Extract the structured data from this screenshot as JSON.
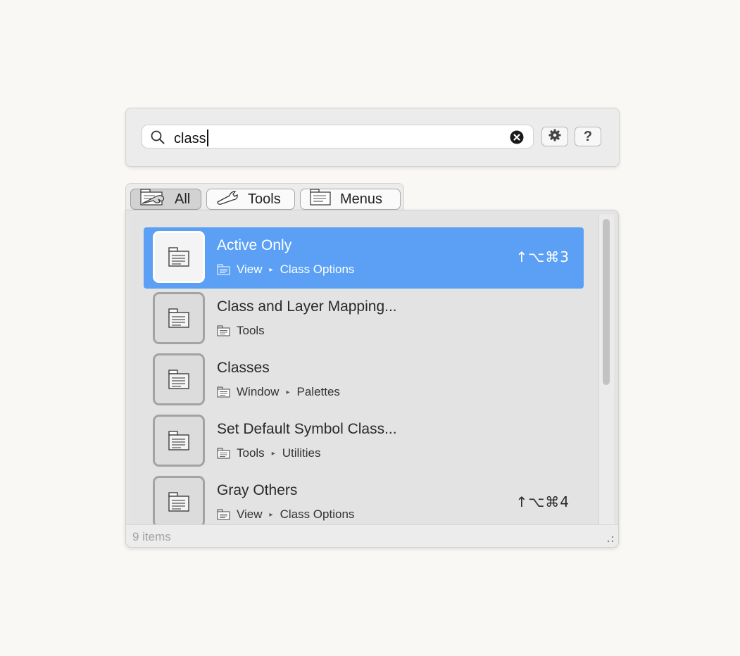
{
  "search": {
    "query": "class",
    "placeholder": ""
  },
  "toolbar": {
    "settings_icon": "gear-icon",
    "help_label": "?"
  },
  "tabs": [
    {
      "label": "All",
      "icon": "tools-and-menus-icon",
      "active": true
    },
    {
      "label": "Tools",
      "icon": "wrench-icon",
      "active": false
    },
    {
      "label": "Menus",
      "icon": "menu-icon",
      "active": false
    }
  ],
  "results": [
    {
      "title": "Active Only",
      "path": [
        "View",
        "Class Options"
      ],
      "shortcut": "↑⌥⌘3",
      "selected": true
    },
    {
      "title": "Class and Layer Mapping...",
      "path": [
        "Tools"
      ],
      "shortcut": "",
      "selected": false
    },
    {
      "title": "Classes",
      "path": [
        "Window",
        "Palettes"
      ],
      "shortcut": "",
      "selected": false
    },
    {
      "title": "Set Default Symbol Class...",
      "path": [
        "Tools",
        "Utilities"
      ],
      "shortcut": "",
      "selected": false
    },
    {
      "title": "Gray Others",
      "path": [
        "View",
        "Class Options"
      ],
      "shortcut": "↑⌥⌘4",
      "selected": false
    }
  ],
  "path_separator": "▸",
  "status": {
    "count_label": "9 items"
  },
  "colors": {
    "selection": "#5ba0f5",
    "panel": "#ececec",
    "list": "#e3e3e3"
  }
}
